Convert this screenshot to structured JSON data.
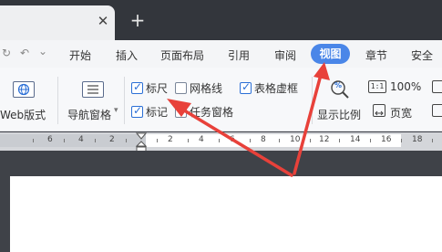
{
  "tabbar": {
    "close_symbol": "✕",
    "new_tab_symbol": "+"
  },
  "quick_access": {
    "redo": "↻",
    "undo": "↶",
    "more": "⌄"
  },
  "menu": {
    "items": [
      "开始",
      "插入",
      "页面布局",
      "引用",
      "审阅",
      "视图",
      "章节",
      "安全"
    ],
    "active": "视图"
  },
  "ribbon": {
    "web_layout": "Web版式",
    "nav_pane": "导航窗格",
    "nav_pane_caret": "▾",
    "ruler": "标尺",
    "gridlines": "网格线",
    "table_gridlines": "表格虚框",
    "marks": "标记",
    "task_pane": "任务窗格",
    "zoom": "显示比例",
    "zoom_100": "100%",
    "page_width": "页宽",
    "one_to_one": "1:1",
    "zoom_glyph": "%"
  },
  "checkboxes": {
    "ruler_checked": true,
    "gridlines_checked": false,
    "table_gridlines_checked": true,
    "marks_checked": true,
    "task_pane_checked": false
  },
  "ruler_marks": [
    "6",
    "4",
    "2",
    "2",
    "4",
    "6",
    "8",
    "10",
    "12",
    "14",
    "16",
    "18"
  ],
  "colors": {
    "accent": "#4a86e8",
    "arrow": "#e8413a",
    "titlebar": "#33363c",
    "workspace": "#3f4248"
  }
}
